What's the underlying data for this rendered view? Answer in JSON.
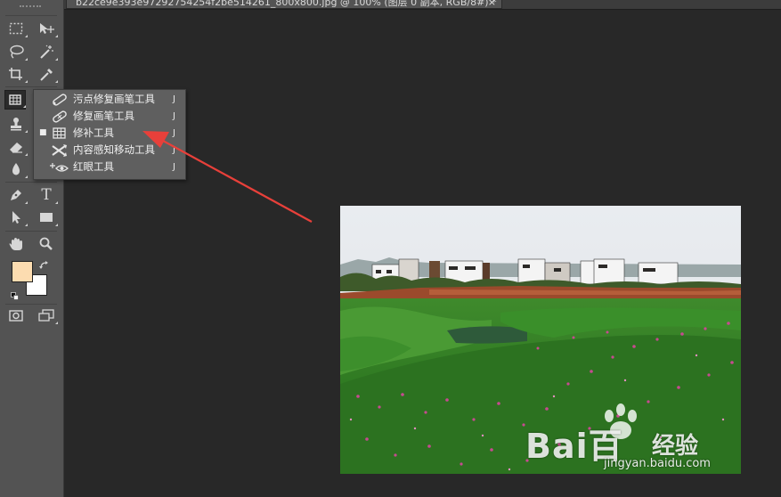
{
  "document": {
    "tab_title": "b22ce9e393e97292754254f2be514261_800x800.jpg @ 100% (图层 0 副本, RGB/8#) *",
    "close_glyph": "×"
  },
  "toolbar": {
    "foreground_color": "#fcdcb0",
    "background_color": "#ffffff",
    "tools": [
      {
        "name": "marquee-tool-icon"
      },
      {
        "name": "move-tool-icon"
      },
      {
        "name": "lasso-tool-icon"
      },
      {
        "name": "magic-wand-tool-icon"
      },
      {
        "name": "crop-tool-icon"
      },
      {
        "name": "eyedropper-tool-icon"
      },
      {
        "name": "patch-tool-icon"
      },
      {
        "name": "clone-stamp-tool-icon"
      },
      {
        "name": "eraser-tool-icon"
      },
      {
        "name": "blur-tool-icon"
      },
      {
        "name": "pen-tool-icon"
      },
      {
        "name": "type-tool-icon",
        "glyph": "T"
      },
      {
        "name": "path-selection-tool-icon"
      },
      {
        "name": "rectangle-tool-icon"
      },
      {
        "name": "hand-tool-icon"
      },
      {
        "name": "zoom-tool-icon"
      },
      {
        "name": "quick-mask-icon"
      },
      {
        "name": "screen-mode-icon"
      }
    ]
  },
  "flyout": {
    "items": [
      {
        "label": "污点修复画笔工具",
        "shortcut": "J",
        "selected": false,
        "icon": "spot-healing-brush-icon"
      },
      {
        "label": "修复画笔工具",
        "shortcut": "J",
        "selected": false,
        "icon": "healing-brush-icon"
      },
      {
        "label": "修补工具",
        "shortcut": "J",
        "selected": true,
        "icon": "patch-icon"
      },
      {
        "label": "内容感知移动工具",
        "shortcut": "J",
        "selected": false,
        "icon": "content-aware-move-icon"
      },
      {
        "label": "红眼工具",
        "shortcut": "J",
        "selected": false,
        "icon": "red-eye-icon"
      }
    ],
    "selected_mark": "■"
  },
  "annotation": {
    "arrow_color": "#e8403a"
  },
  "watermark": {
    "brand": "Bai百",
    "brand_cn": "经验",
    "url": "jingyan.baidu.com"
  }
}
